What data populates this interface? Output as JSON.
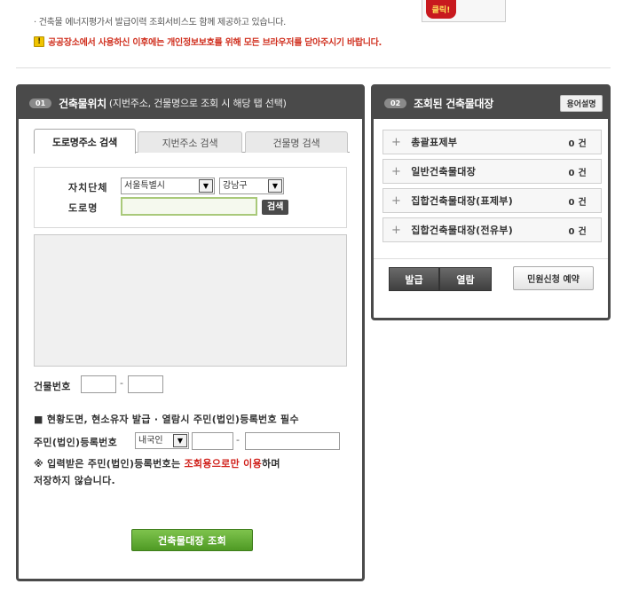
{
  "notices": {
    "energy": "· 건축물 에너지평가서 발급이력 조회서비스도 함께 제공하고 있습니다.",
    "warning_icon": "!",
    "warning": "공공장소에서 사용하신 이후에는 개인정보보호를 위해 모든 브라우저를 닫아주시기 바랍니다.",
    "click_badge": "클릭!"
  },
  "location_panel": {
    "number": "01",
    "title": "건축물위치",
    "subtitle": "(지번주소, 건물명으로 조회 시 해당 탭 선택)",
    "tabs": [
      "도로명주소 검색",
      "지번주소 검색",
      "건물명 검색"
    ],
    "form": {
      "region_label": "자치단체",
      "city_value": "서울특별시",
      "district_value": "강남구",
      "road_label": "도로명",
      "road_value": "",
      "search_button": "검색",
      "building_no_label": "건물번호",
      "building_no_main": "",
      "building_no_sub": "",
      "dash": "-"
    },
    "id_section": {
      "notice": "■ 현황도면, 현소유자 발급 · 열람시 주민(법인)등록번호 필수",
      "id_label": "주민(법인)등록번호",
      "nationality_value": "내국인",
      "id_front": "",
      "id_back": "",
      "disclaimer_before": "※ 입력받은 주민(법인)등록번호는 ",
      "disclaimer_red": "조회용으로만 이용",
      "disclaimer_after": "하며",
      "disclaimer_line2": "저장하지 않습니다."
    },
    "lookup_button": "건축물대장 조회"
  },
  "registry_panel": {
    "number": "02",
    "title": "조회된 건축물대장",
    "help_button": "용어설명",
    "rows": [
      {
        "label": "총괄표제부",
        "count": "0 건"
      },
      {
        "label": "일반건축물대장",
        "count": "0 건"
      },
      {
        "label": "집합건축물대장(표제부)",
        "count": "0 건"
      },
      {
        "label": "집합건축물대장(전유부)",
        "count": "0 건"
      }
    ],
    "issue_button": "발급",
    "view_button": "열람",
    "request_button": "민원신청 예약"
  },
  "icons": {
    "warning": "warning-icon",
    "dropdown": "chevron-down-icon",
    "expand": "plus-icon"
  },
  "colors": {
    "panel_header": "#4a4a4a",
    "warning_text": "#d0301f",
    "accent_green": "#5aa42c"
  }
}
